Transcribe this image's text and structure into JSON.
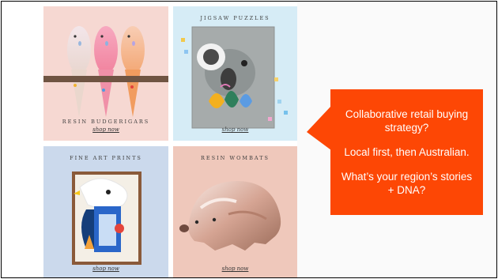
{
  "products": [
    {
      "title": "RESIN BUDGERIGARS",
      "link": "shop now"
    },
    {
      "title": "JIGSAW PUZZLES",
      "link": "shop now"
    },
    {
      "title": "FINE ART PRINTS",
      "link": "shop now"
    },
    {
      "title": "RESIN WOMBATS",
      "link": "shop now"
    }
  ],
  "callout": {
    "line1": "Collaborative retail buying strategy?",
    "line2": "Local first, then Australian.",
    "line3": "What’s your region’s stories + DNA?"
  },
  "colors": {
    "callout": "#fd4705",
    "budgerigar_tile": "#f6d8d2",
    "puzzle_tile": "#d6ecf6",
    "prints_tile": "#cbd9ec",
    "wombat_tile": "#efc8bb"
  }
}
